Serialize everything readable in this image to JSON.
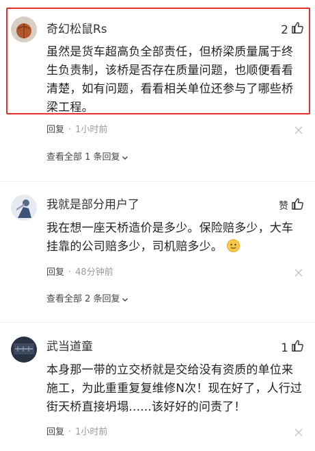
{
  "comments": [
    {
      "username": "奇幻松鼠Rs",
      "like": "2",
      "text": "虽然是货车超高负全部责任，但桥梁质量属于终生负责制，该桥是否存在质量问题，也顺便看看清楚，如有问题，看看相关单位还参与了哪些桥梁工程。",
      "reply": "回复",
      "time": "1小时前",
      "view_all": "查看全部 1 条回复"
    },
    {
      "username": "我就是部分用户了",
      "like": "赞",
      "text": "我在想一座天桥造价是多少。保险赔多少，大车挂靠的公司赔多少，司机赔多少。",
      "reply": "回复",
      "time": "48分钟前",
      "view_all": "查看全部 2 条回复"
    },
    {
      "username": "武当道童",
      "like": "1",
      "text": "本身那一带的立交桥就是交给没有资质的单位来施工，为此重重复复维修N次！现在好了，人行过街天桥直接坍塌......该好好的问责了！",
      "reply": "回复",
      "time": "1小时前"
    }
  ],
  "separator": "·",
  "accent_color": "#e5302d"
}
